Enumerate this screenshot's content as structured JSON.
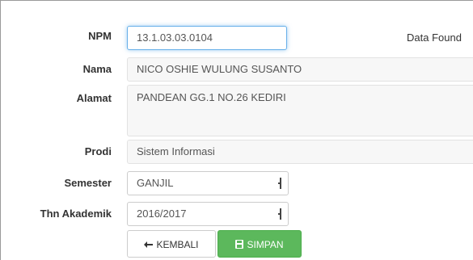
{
  "form": {
    "npm": {
      "label": "NPM",
      "value": "13.1.03.03.0104"
    },
    "status": "Data Found",
    "nama": {
      "label": "Nama",
      "value": "NICO OSHIE WULUNG SUSANTO"
    },
    "alamat": {
      "label": "Alamat",
      "value": "PANDEAN GG.1 NO.26 KEDIRI"
    },
    "prodi": {
      "label": "Prodi",
      "value": "Sistem Informasi"
    },
    "semester": {
      "label": "Semester",
      "value": "GANJIL"
    },
    "thn_akademik": {
      "label": "Thn Akademik",
      "value": "2016/2017"
    }
  },
  "buttons": {
    "kembali": {
      "label": "KEMBALI",
      "icon": "arrow-left-icon"
    },
    "simpan": {
      "label": "SIMPAN",
      "icon": "floppy-icon"
    }
  },
  "colors": {
    "focus_border": "#66afe9",
    "success": "#5cb85c"
  }
}
